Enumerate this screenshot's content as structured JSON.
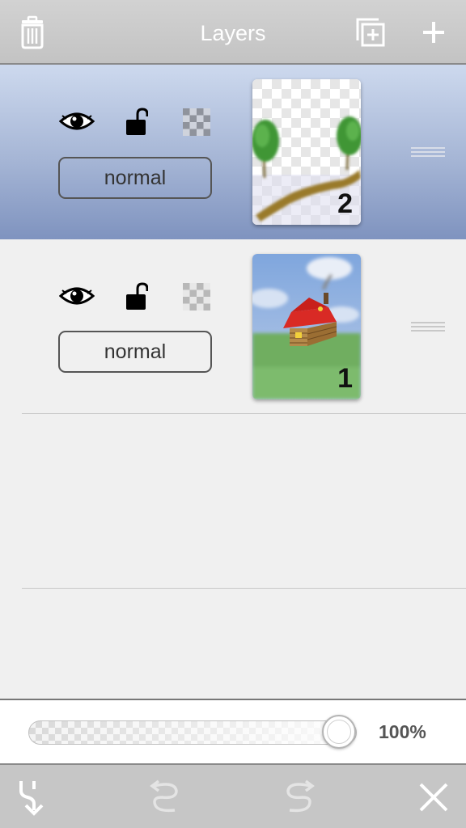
{
  "header": {
    "title": "Layers",
    "delete_icon": "trash-icon",
    "duplicate_icon": "duplicate-layer-icon",
    "add_icon": "plus-icon"
  },
  "layers": [
    {
      "number": "2",
      "blend_mode": "normal",
      "selected": true,
      "visible": true,
      "locked": false,
      "thumbnail": "trees and dirt path on transparent background"
    },
    {
      "number": "1",
      "blend_mode": "normal",
      "selected": false,
      "visible": true,
      "locked": false,
      "thumbnail": "red-roofed cabin on green field under blue sky"
    }
  ],
  "opacity": {
    "value": 1.0,
    "label": "100%"
  },
  "footer": {
    "merge_icon": "merge-down-icon",
    "undo_icon": "undo-icon",
    "redo_icon": "redo-icon",
    "close_icon": "close-icon"
  },
  "colors": {
    "selected_top": "#cdd9ee",
    "selected_bottom": "#7f93bf",
    "bar": "#c6c6c6"
  }
}
